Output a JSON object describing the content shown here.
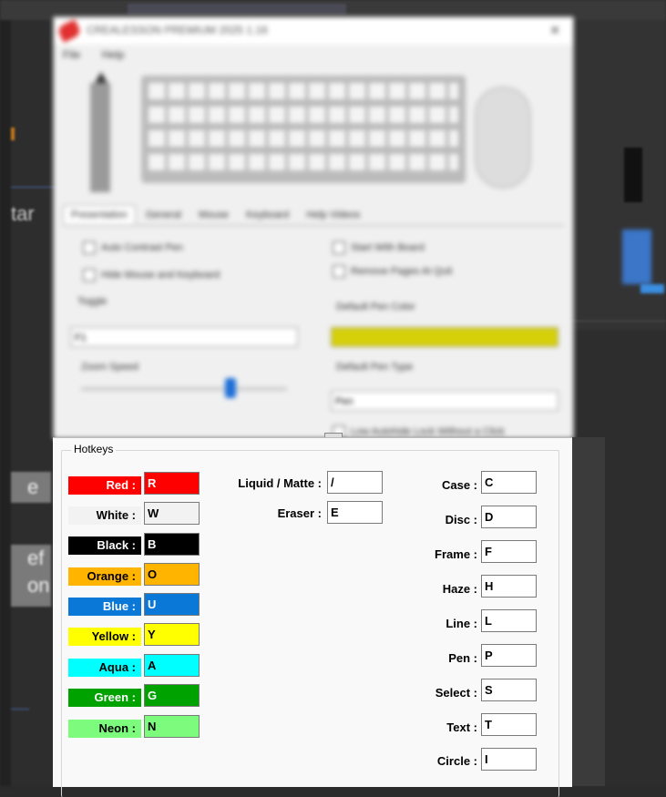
{
  "colors": {
    "red": "#ff0000",
    "white": "#f2f2f2",
    "black": "#000000",
    "orange": "#ffb400",
    "blue": "#0a78d7",
    "yellow": "#ffff00",
    "aqua": "#00ffff",
    "green": "#00a200",
    "neon": "#7cfb7c",
    "pen_default": "#d6d00a",
    "accent": "#1e6fd8"
  },
  "background": {
    "left_snippets": [
      "tar",
      "e",
      "ef",
      "on"
    ]
  },
  "settings_window": {
    "title": "CREALESSON PREMIUM 2025 1.16",
    "close_glyph": "✕",
    "menu": [
      "File",
      "Help"
    ],
    "tabs": [
      "Presentation",
      "General",
      "Mouse",
      "Keyboard",
      "Help Videos"
    ],
    "checkboxes": [
      "Auto Contrast Pen",
      "Hide Mouse and Keyboard",
      "Start With Board",
      "Remove Pages At Quit"
    ],
    "toggle_label": "Toggle",
    "toggle_value": "F1",
    "zoom_speed_label": "Zoom Speed",
    "default_pen_color_label": "Default Pen Color",
    "default_pen_type_label": "Default Pen Type",
    "default_pen_type_value": "Pen",
    "bottom_checkbox": "Low Autohide Lock Without a Click"
  },
  "hotkeys": {
    "title": "Hotkeys",
    "colors": [
      {
        "label": "Red :",
        "key": "R"
      },
      {
        "label": "White :",
        "key": "W"
      },
      {
        "label": "Black :",
        "key": "B"
      },
      {
        "label": "Orange :",
        "key": "O"
      },
      {
        "label": "Blue :",
        "key": "U"
      },
      {
        "label": "Yellow :",
        "key": "Y"
      },
      {
        "label": "Aqua :",
        "key": "A"
      },
      {
        "label": "Green :",
        "key": "G"
      },
      {
        "label": "Neon :",
        "key": "N"
      }
    ],
    "middle": [
      {
        "label": "Liquid / Matte :",
        "key": "/"
      },
      {
        "label": "Eraser :",
        "key": "E"
      }
    ],
    "tools": [
      {
        "label": "Case :",
        "key": "C"
      },
      {
        "label": "Disc :",
        "key": "D"
      },
      {
        "label": "Frame :",
        "key": "F"
      },
      {
        "label": "Haze :",
        "key": "H"
      },
      {
        "label": "Line :",
        "key": "L"
      },
      {
        "label": "Pen :",
        "key": "P"
      },
      {
        "label": "Select :",
        "key": "S"
      },
      {
        "label": "Text :",
        "key": "T"
      },
      {
        "label": "Circle :",
        "key": "I"
      }
    ]
  }
}
